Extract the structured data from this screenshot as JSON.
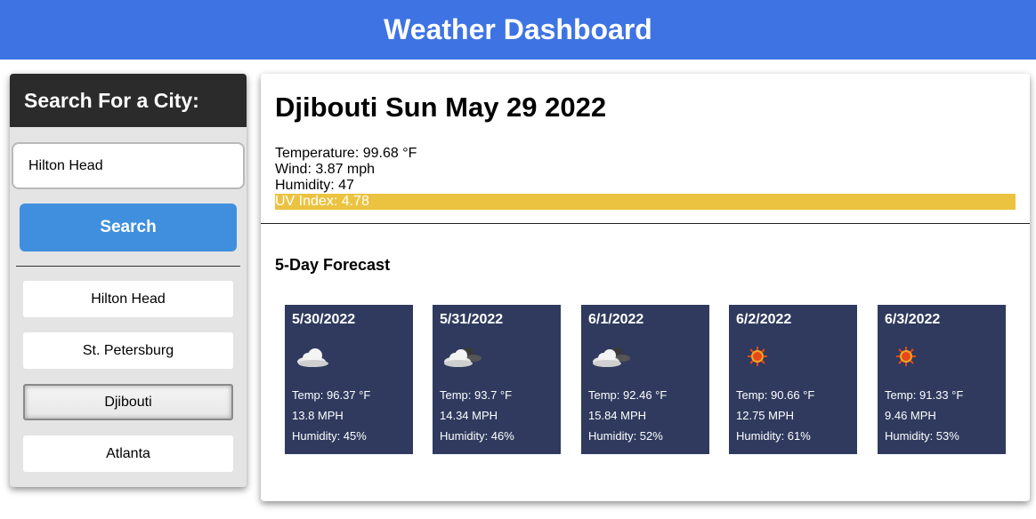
{
  "header": {
    "title": "Weather Dashboard"
  },
  "sidebar": {
    "title": "Search For a City:",
    "search_value": "Hilton Head",
    "search_button": "Search",
    "history": [
      {
        "label": "Hilton Head"
      },
      {
        "label": "St. Petersburg"
      },
      {
        "label": "Djibouti"
      },
      {
        "label": "Atlanta"
      }
    ]
  },
  "current": {
    "heading": "Djibouti Sun May 29 2022",
    "temperature": "Temperature: 99.68 °F",
    "wind": "Wind: 3.87 mph",
    "humidity": "Humidity: 47",
    "uv": "UV Index: 4.78"
  },
  "forecast": {
    "title": "5-Day Forecast",
    "days": [
      {
        "date": "5/30/2022",
        "icon": "cloud-icon",
        "temp": "Temp: 96.37 °F",
        "wind": "13.8 MPH",
        "humidity": "Humidity: 45%"
      },
      {
        "date": "5/31/2022",
        "icon": "cloud-dark-icon",
        "temp": "Temp: 93.7 °F",
        "wind": "14.34 MPH",
        "humidity": "Humidity: 46%"
      },
      {
        "date": "6/1/2022",
        "icon": "cloud-dark-icon",
        "temp": "Temp: 92.46 °F",
        "wind": "15.84 MPH",
        "humidity": "Humidity: 52%"
      },
      {
        "date": "6/2/2022",
        "icon": "sun-icon",
        "temp": "Temp: 90.66 °F",
        "wind": "12.75 MPH",
        "humidity": "Humidity: 61%"
      },
      {
        "date": "6/3/2022",
        "icon": "sun-icon",
        "temp": "Temp: 91.33 °F",
        "wind": "9.46 MPH",
        "humidity": "Humidity: 53%"
      }
    ]
  },
  "colors": {
    "header": "#3e73e3",
    "search_button": "#3f8fde",
    "uv_moderate": "#ebc341",
    "forecast_card": "#2f3a5e"
  }
}
